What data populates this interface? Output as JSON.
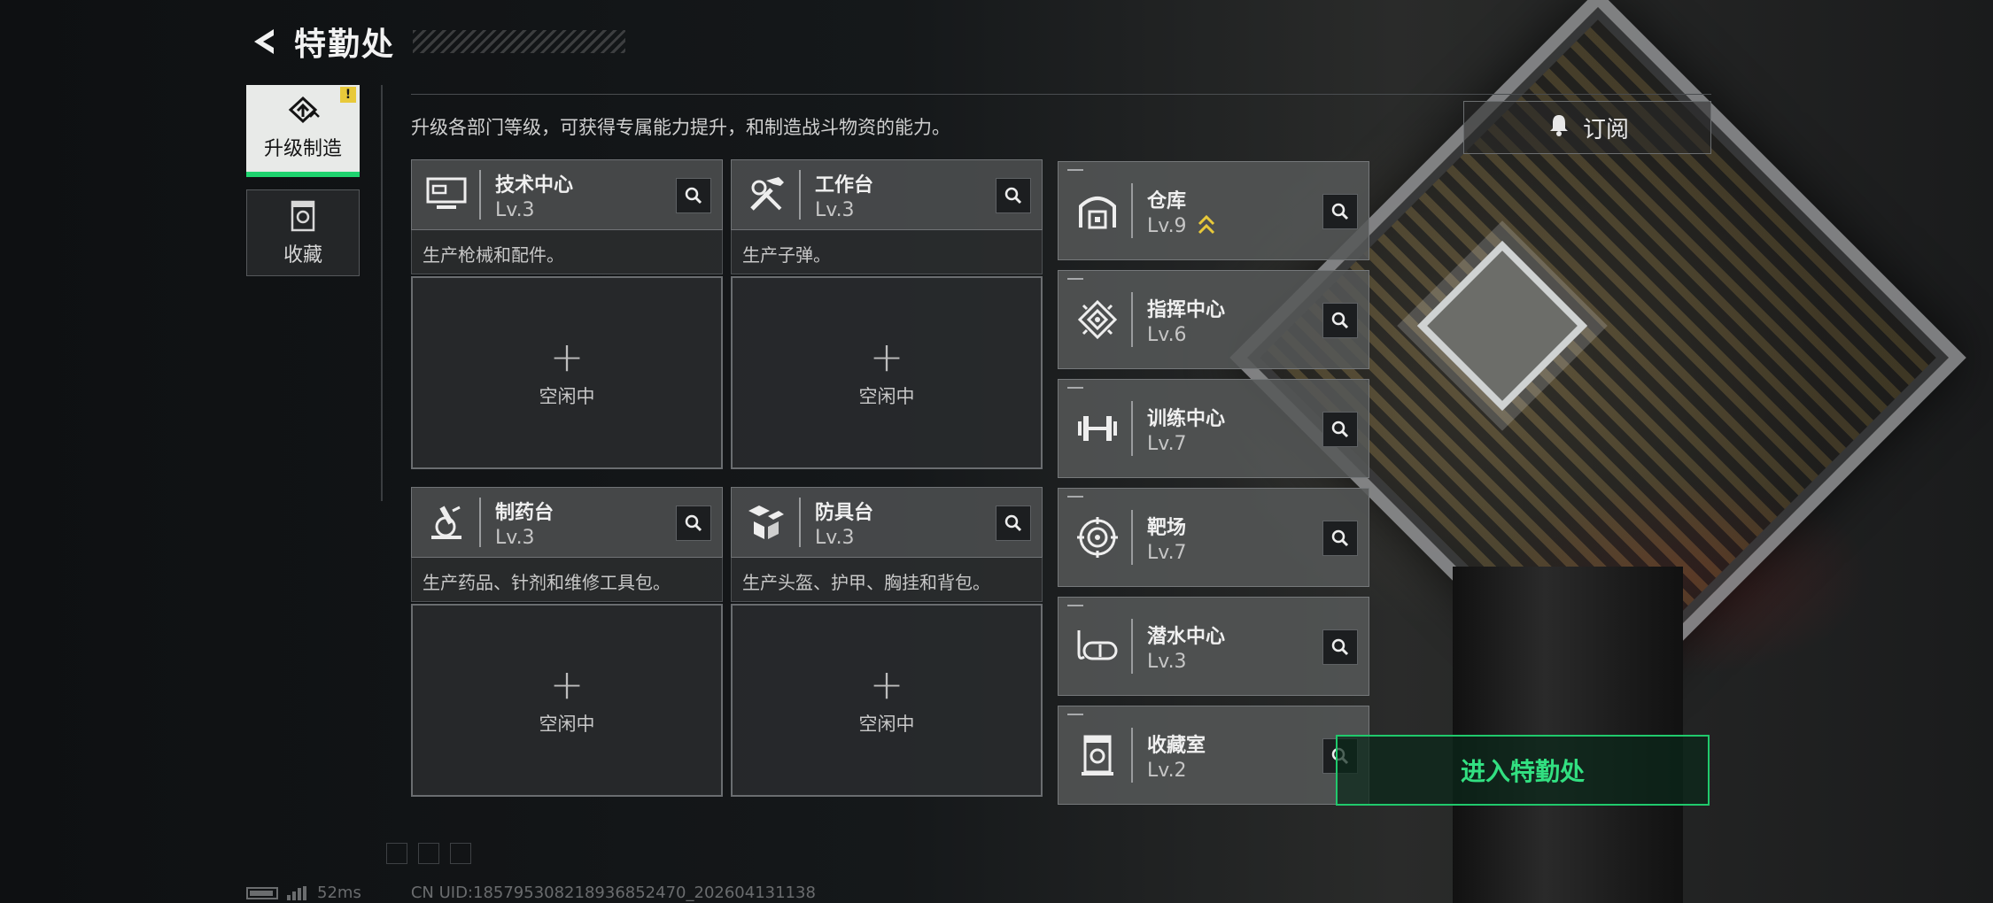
{
  "header": {
    "title": "特勤处"
  },
  "rail": {
    "tabs": [
      {
        "label": "升级制造",
        "badge": "!"
      },
      {
        "label": "收藏"
      }
    ]
  },
  "description": "升级各部门等级，可获得专属能力提升，和制造战斗物资的能力。",
  "subscribe_label": "订阅",
  "stations": [
    {
      "name": "技术中心",
      "level": "Lv.3",
      "desc": "生产枪械和配件。",
      "slot_status": "空闲中",
      "icon": "monitor-icon"
    },
    {
      "name": "工作台",
      "level": "Lv.3",
      "desc": "生产子弹。",
      "slot_status": "空闲中",
      "icon": "tools-icon"
    },
    {
      "name": "制药台",
      "level": "Lv.3",
      "desc": "生产药品、针剂和维修工具包。",
      "slot_status": "空闲中",
      "icon": "microscope-icon"
    },
    {
      "name": "防具台",
      "level": "Lv.3",
      "desc": "生产头盔、护甲、胸挂和背包。",
      "slot_status": "空闲中",
      "icon": "armor-blocks-icon"
    }
  ],
  "facilities": [
    {
      "name": "仓库",
      "level": "Lv.9",
      "icon": "warehouse-icon",
      "upgrade_indicator": "double-chevron-up-icon"
    },
    {
      "name": "指挥中心",
      "level": "Lv.6",
      "icon": "chip-icon"
    },
    {
      "name": "训练中心",
      "level": "Lv.7",
      "icon": "dumbbell-icon"
    },
    {
      "name": "靶场",
      "level": "Lv.7",
      "icon": "target-icon"
    },
    {
      "name": "潜水中心",
      "level": "Lv.3",
      "icon": "diving-mask-icon"
    },
    {
      "name": "收藏室",
      "level": "Lv.2",
      "icon": "display-case-icon"
    }
  ],
  "enter_button": "进入特勤处",
  "footer": {
    "ping": "52ms",
    "uid": "CN UID:18579530821893685247​0_202604131138"
  },
  "colors": {
    "accent": "#1fd36f",
    "badge": "#e8c93a",
    "enter_text": "#32e081"
  }
}
